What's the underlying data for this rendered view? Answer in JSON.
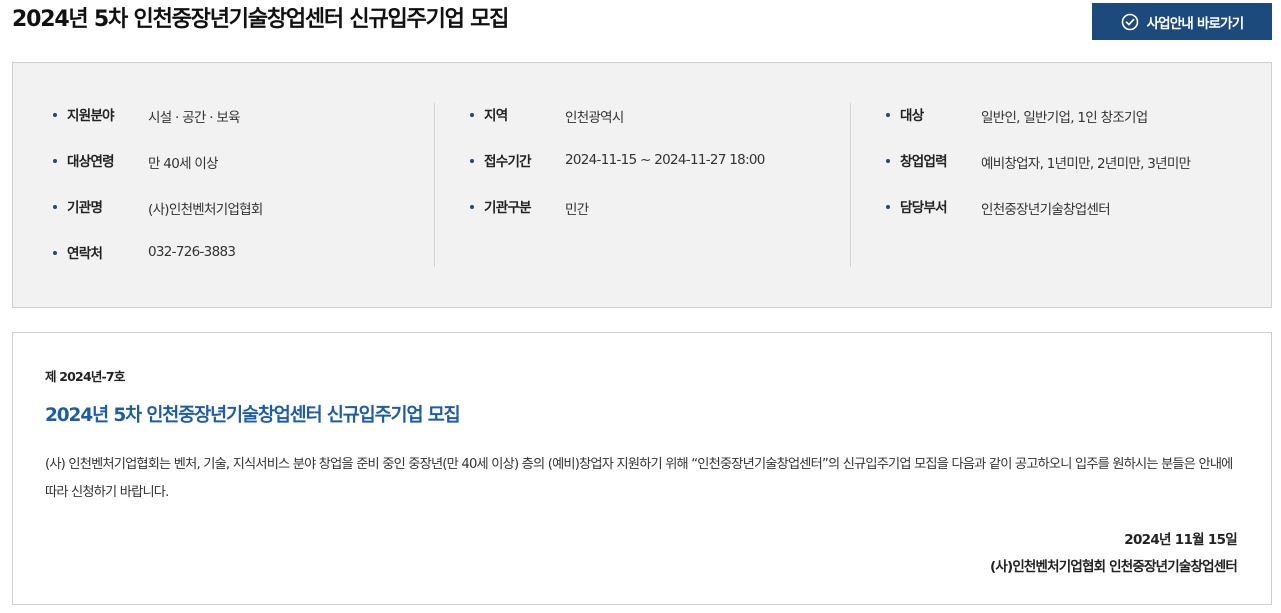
{
  "header": {
    "title": "2024년 5차 인천중장년기술창업센터 신규입주기업 모집",
    "shortcut_label": "사업안내 바로가기",
    "shortcut_icon": "check-circle-icon"
  },
  "info": {
    "col1": [
      {
        "label": "지원분야",
        "value": "시설 · 공간 · 보육"
      },
      {
        "label": "대상연령",
        "value": "만 40세 이상"
      },
      {
        "label": "기관명",
        "value": "(사)인천벤처기업협회"
      },
      {
        "label": "연락처",
        "value": "032-726-3883"
      }
    ],
    "col2": [
      {
        "label": "지역",
        "value": "인천광역시"
      },
      {
        "label": "접수기간",
        "value": "2024-11-15 ~ 2024-11-27 18:00"
      },
      {
        "label": "기관구분",
        "value": "민간"
      }
    ],
    "col3": [
      {
        "label": "대상",
        "value": "일반인, 일반기업, 1인 창조기업"
      },
      {
        "label": "창업업력",
        "value": "예비창업자, 1년미만, 2년미만, 3년미만"
      },
      {
        "label": "담당부서",
        "value": "인천중장년기술창업센터"
      }
    ]
  },
  "notice": {
    "number": "제 2024년-7호",
    "title": "2024년 5차 인천중장년기술창업센터 신규입주기업 모집",
    "body": "(사) 인천벤처기업협회는 벤처, 기술, 지식서비스 분야 창업을 준비 중인 중장년(만 40세 이상) 층의 (예비)창업자 지원하기 위해 “인천중장년기술창업센터”의 신규입주기업 모집을 다음과 같이 공고하오니 입주를 원하시는 분들은 안내에 따라 신청하기 바랍니다.",
    "date": "2024년 11월 15일",
    "organization": "(사)인천벤처기업협회 인천중장년기술창업센터"
  },
  "colors": {
    "accent": "#1d4a7d",
    "title_blue": "#1d5da8",
    "panel_bg": "#f2f2f2"
  }
}
